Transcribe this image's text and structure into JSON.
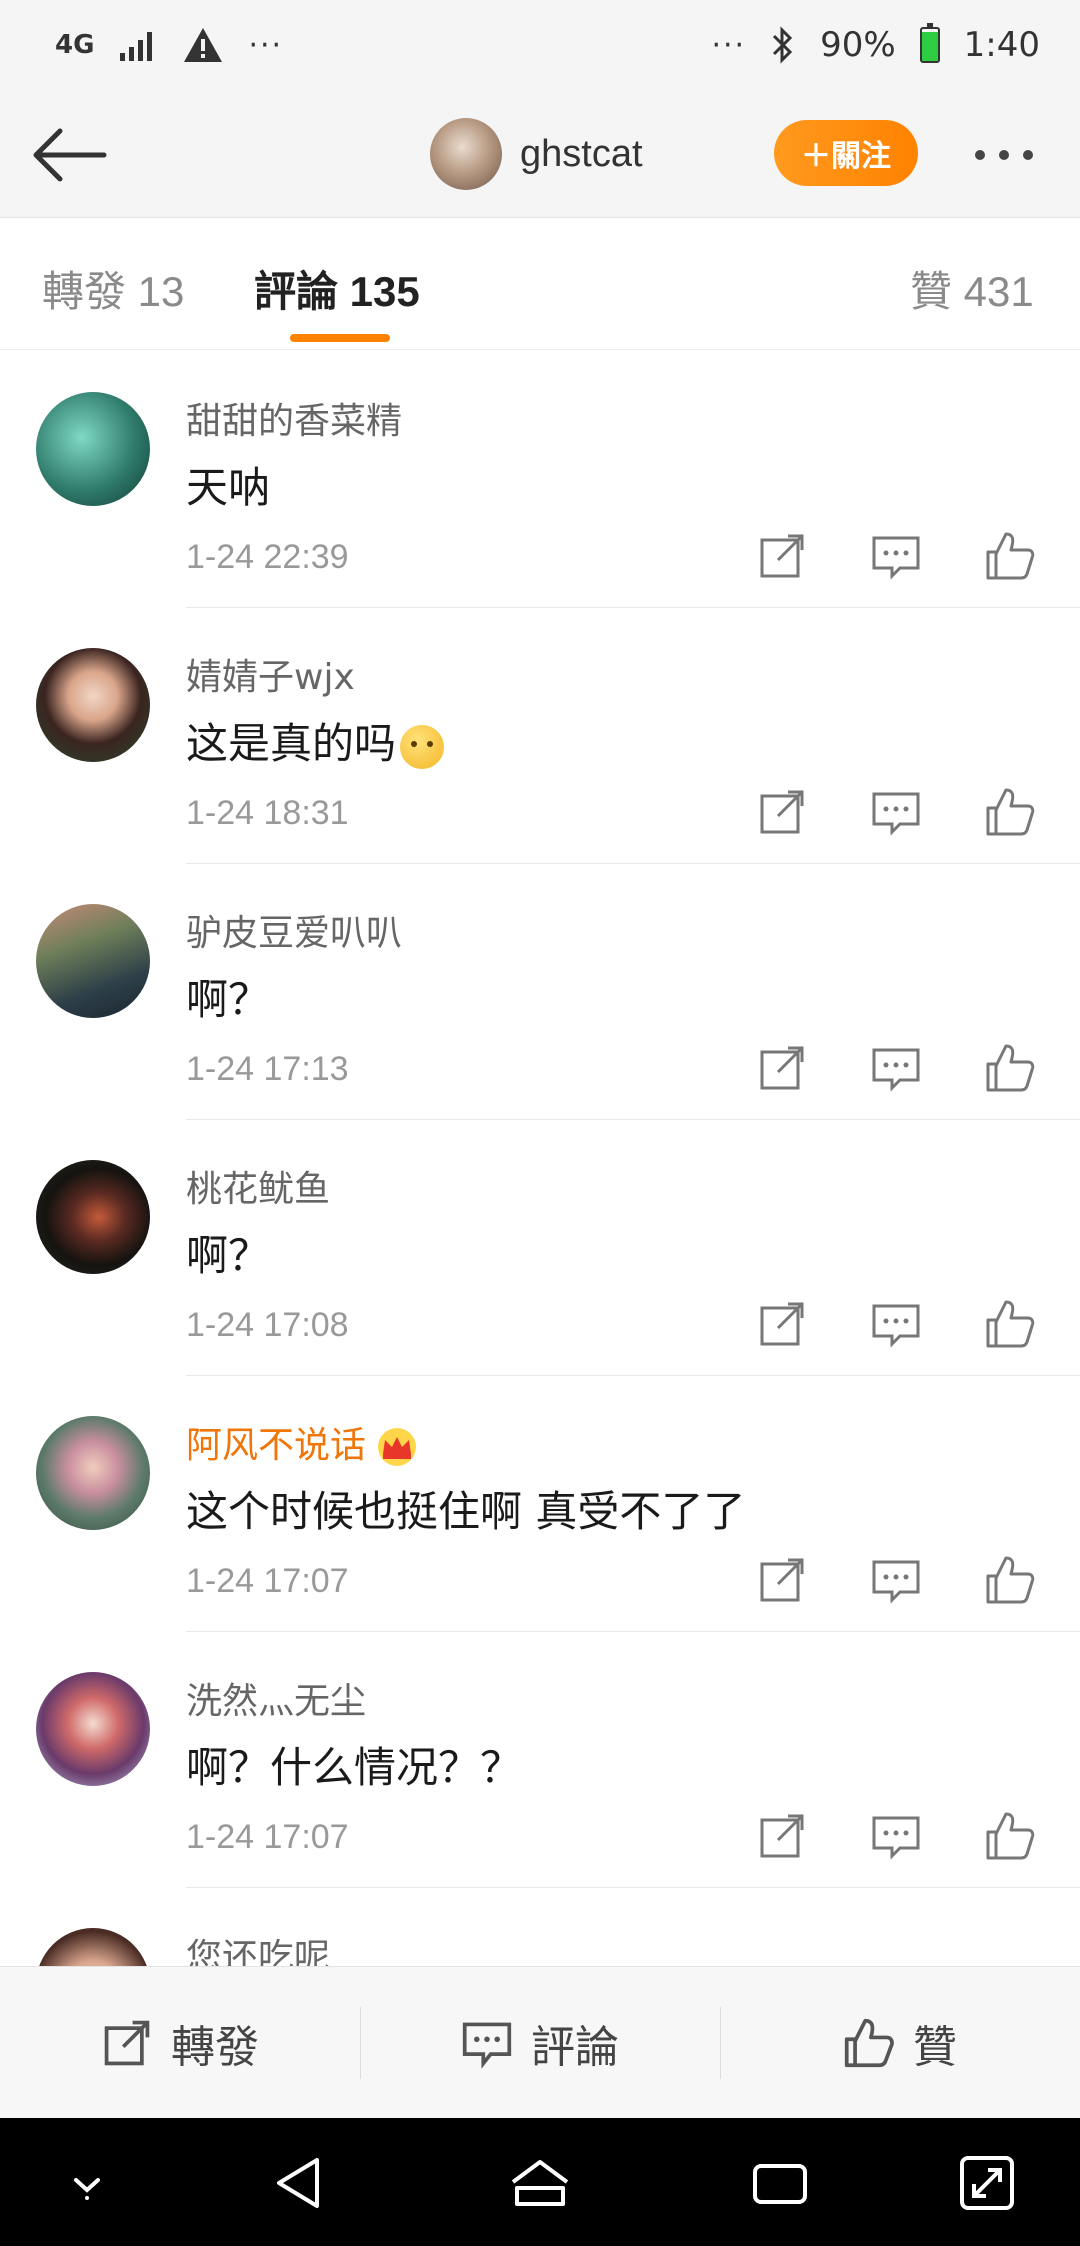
{
  "status_bar": {
    "network": "4G",
    "left_dots": "···",
    "right_dots": "···",
    "battery_percent": "90%",
    "time": "1:40",
    "icons": [
      "signal-icon",
      "warning-icon",
      "bluetooth-icon",
      "battery-icon"
    ]
  },
  "header": {
    "username": "ghstcat",
    "follow_label": "＋關注"
  },
  "tabs": [
    {
      "label": "轉發 13"
    },
    {
      "label": "評論 135"
    },
    {
      "label": "贊 431"
    }
  ],
  "comments": [
    {
      "username": "甜甜的香菜精",
      "text": "天呐",
      "time": "1-24 22:39"
    },
    {
      "username": "婧婧子wjx",
      "text": "这是真的吗",
      "time": "1-24 18:31"
    },
    {
      "username": "驴皮豆爱叭叭",
      "text": "啊？",
      "time": "1-24 17:13"
    },
    {
      "username": "桃花鱿鱼",
      "text": "啊？",
      "time": "1-24 17:08"
    },
    {
      "username": "阿风不说话",
      "text": "这个时候也挺住啊 真受不了了",
      "time": "1-24 17:07"
    },
    {
      "username": "洗然灬无尘",
      "text": "啊？什么情况？？",
      "time": "1-24 17:07"
    },
    {
      "username": "您还吃呢",
      "text": "",
      "time": ""
    }
  ],
  "bottom_bar": {
    "repost": "轉發",
    "comment": "評論",
    "like": "贊"
  },
  "colors": {
    "accent": "#ff8200",
    "vip_name": "#f0760a"
  }
}
